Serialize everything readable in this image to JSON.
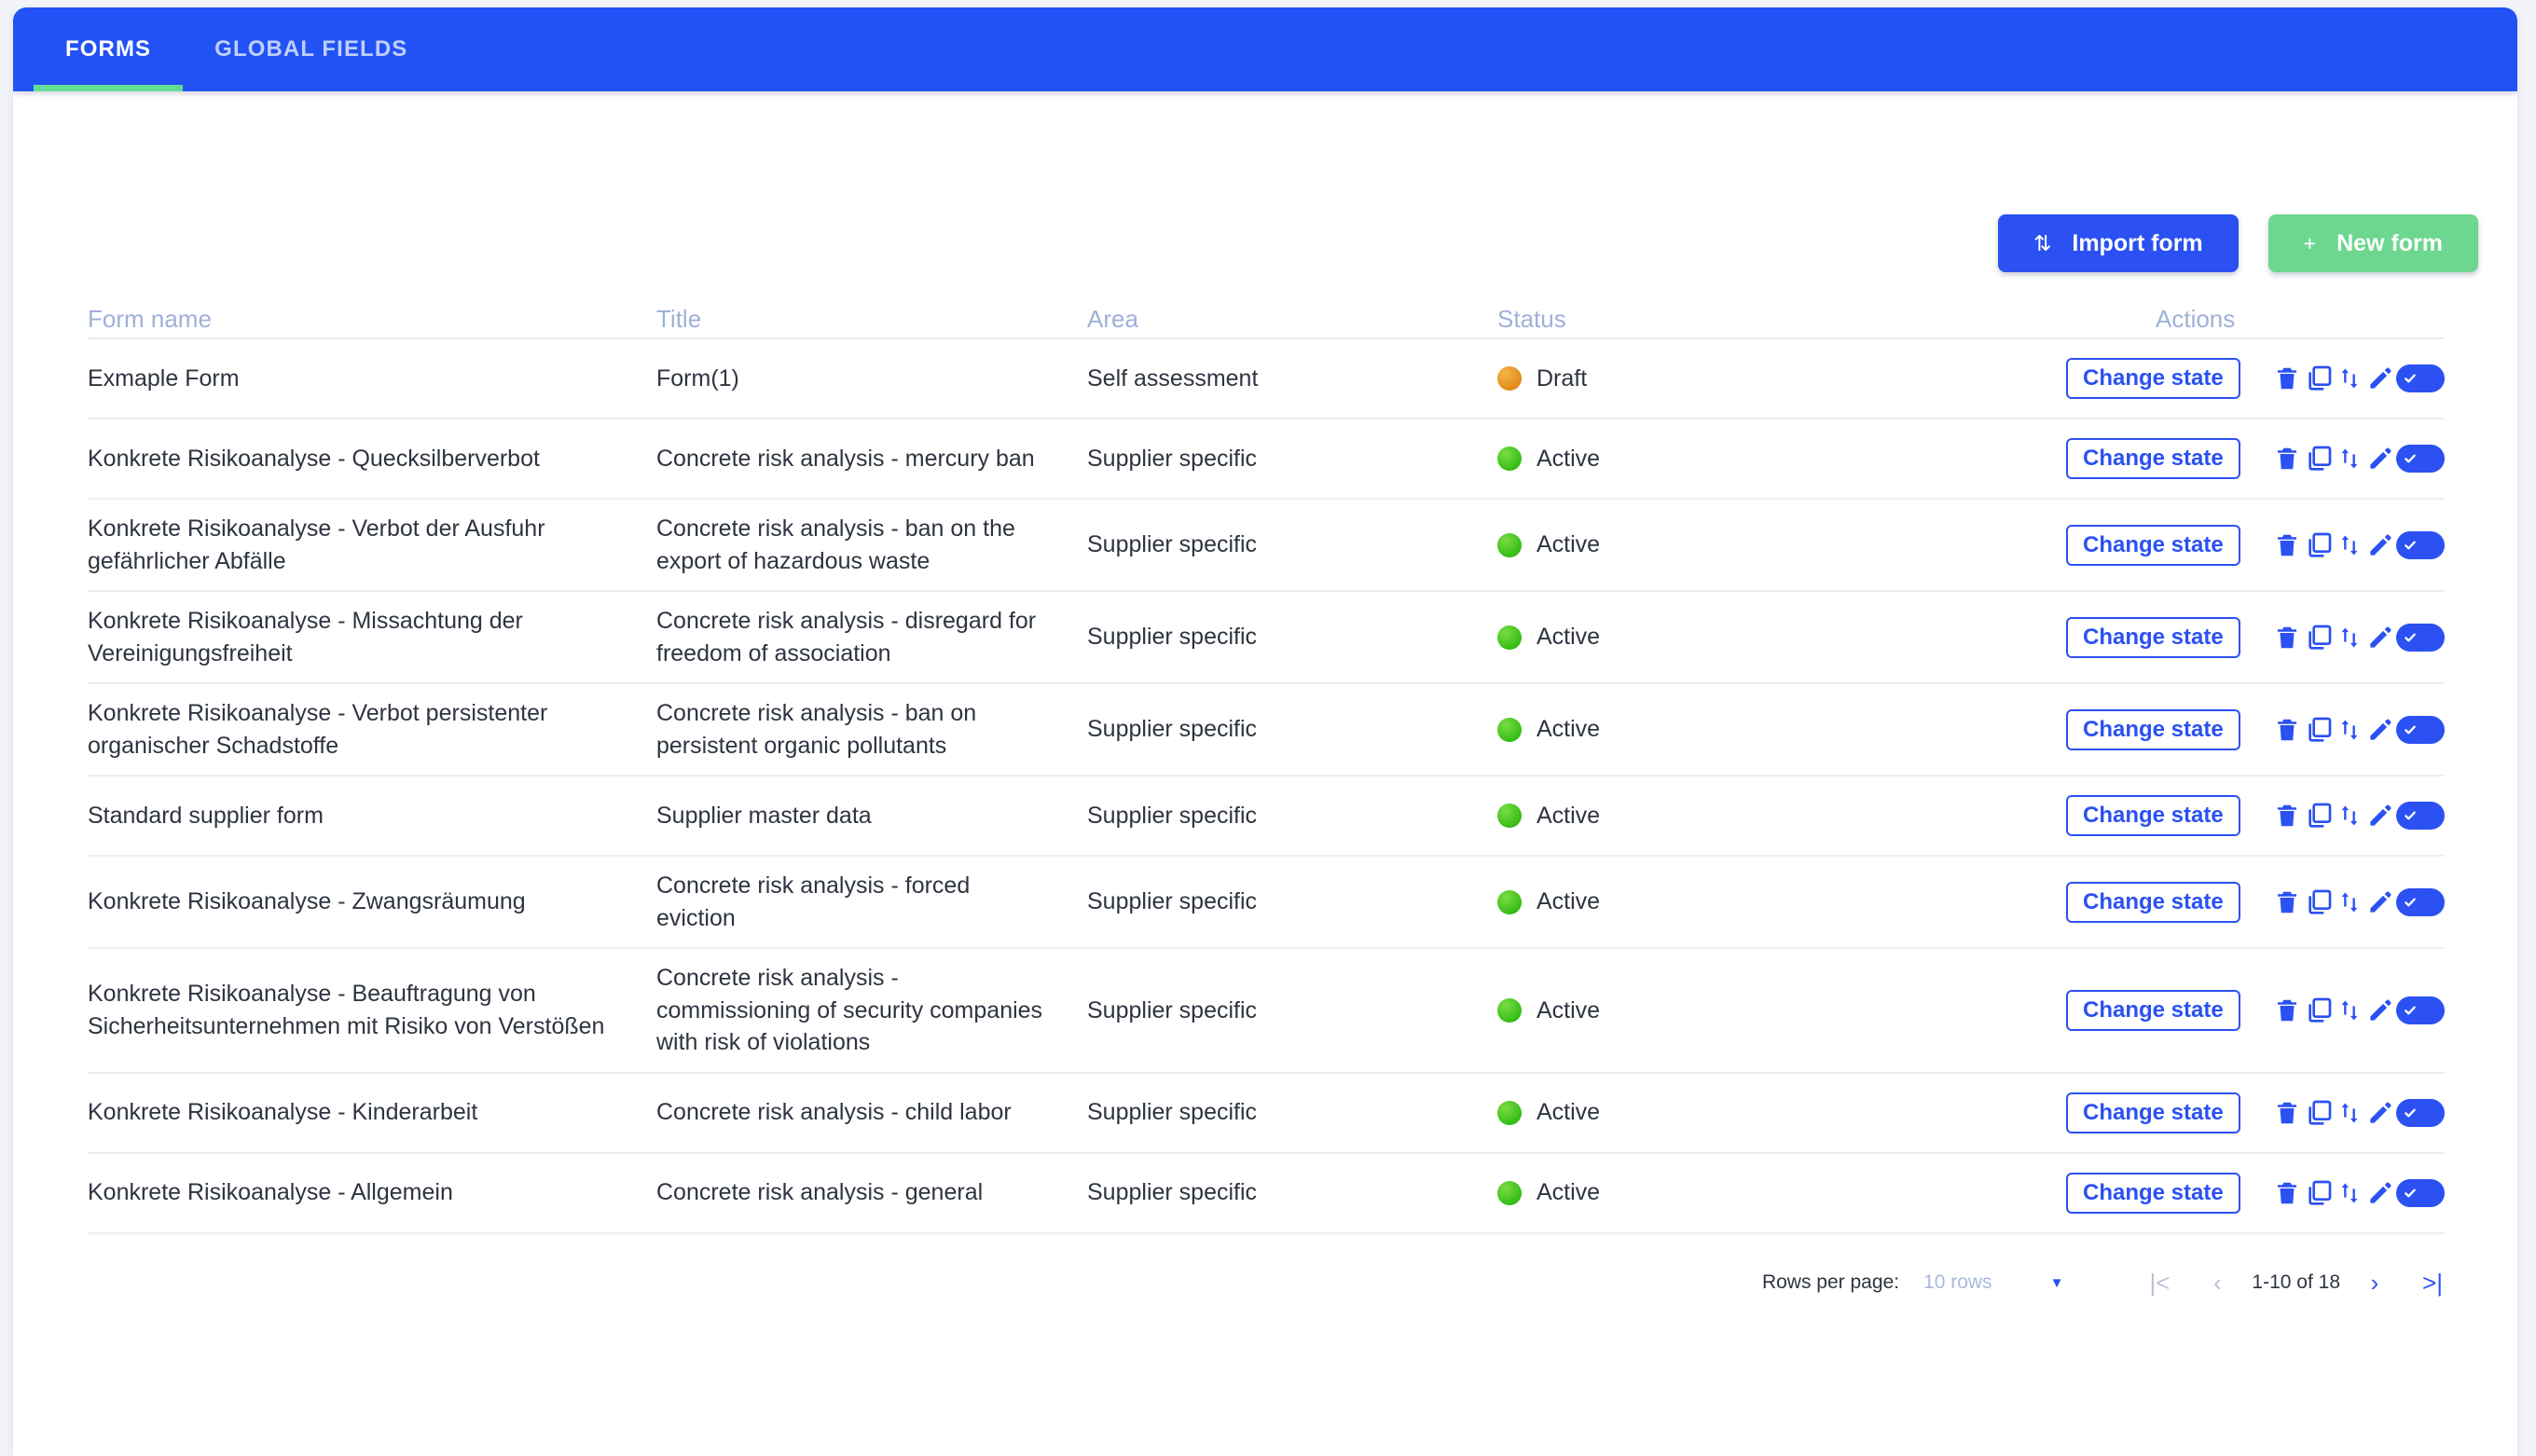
{
  "tabs": [
    {
      "label": "FORMS",
      "active": true
    },
    {
      "label": "GLOBAL FIELDS",
      "active": false
    }
  ],
  "toolbar": {
    "import_label": "Import form",
    "import_icon": "import-arrows-icon",
    "new_label": "New form",
    "new_icon": "plus-icon"
  },
  "table": {
    "columns": [
      "Form name",
      "Title",
      "Area",
      "Status",
      "Actions"
    ],
    "row_actions": {
      "change_state_label": "Change state",
      "icons": [
        "delete-icon",
        "duplicate-icon",
        "export-icon",
        "edit-icon",
        "active-toggle"
      ]
    },
    "rows": [
      {
        "name": "Exmaple Form",
        "title": "Form(1)",
        "area": "Self assessment",
        "status": "Draft",
        "status_type": "draft"
      },
      {
        "name": "Konkrete Risikoanalyse - Quecksilberverbot",
        "title": "Concrete risk analysis - mercury ban",
        "area": "Supplier specific",
        "status": "Active",
        "status_type": "active"
      },
      {
        "name": "Konkrete Risikoanalyse - Verbot der Ausfuhr gefährlicher Abfälle",
        "title": "Concrete risk analysis - ban on the export of hazardous waste",
        "area": "Supplier specific",
        "status": "Active",
        "status_type": "active"
      },
      {
        "name": "Konkrete Risikoanalyse - Missachtung der Vereinigungsfreiheit",
        "title": "Concrete risk analysis - disregard for freedom of association",
        "area": "Supplier specific",
        "status": "Active",
        "status_type": "active"
      },
      {
        "name": "Konkrete Risikoanalyse - Verbot persistenter organischer Schadstoffe",
        "title": "Concrete risk analysis - ban on persistent organic pollutants",
        "area": "Supplier specific",
        "status": "Active",
        "status_type": "active"
      },
      {
        "name": "Standard supplier form",
        "title": "Supplier master data",
        "area": "Supplier specific",
        "status": "Active",
        "status_type": "active"
      },
      {
        "name": "Konkrete Risikoanalyse - Zwangsräumung",
        "title": "Concrete risk analysis - forced eviction",
        "area": "Supplier specific",
        "status": "Active",
        "status_type": "active"
      },
      {
        "name": "Konkrete Risikoanalyse - Beauftragung von Sicherheitsunternehmen mit Risiko von Verstößen",
        "title": "Concrete risk analysis - commissioning of security companies with risk of violations",
        "area": "Supplier specific",
        "status": "Active",
        "status_type": "active"
      },
      {
        "name": "Konkrete Risikoanalyse - Kinderarbeit",
        "title": "Concrete risk analysis - child labor",
        "area": "Supplier specific",
        "status": "Active",
        "status_type": "active"
      },
      {
        "name": "Konkrete Risikoanalyse - Allgemein",
        "title": "Concrete risk analysis - general",
        "area": "Supplier specific",
        "status": "Active",
        "status_type": "active"
      }
    ]
  },
  "pagination": {
    "rows_per_page_label": "Rows per page:",
    "rows_per_page_value": "10 rows",
    "range": "1-10 of 18",
    "first_icon": "|<",
    "prev_icon": "‹",
    "next_icon": "›",
    "last_icon": ">|"
  },
  "colors": {
    "header_blue": "#2252f5",
    "accent_green": "#63dd94",
    "action_blue": "#2b51f2",
    "status_draft": "#e08a18",
    "status_active": "#35bd15",
    "page_bg": "#f2f4fa"
  }
}
